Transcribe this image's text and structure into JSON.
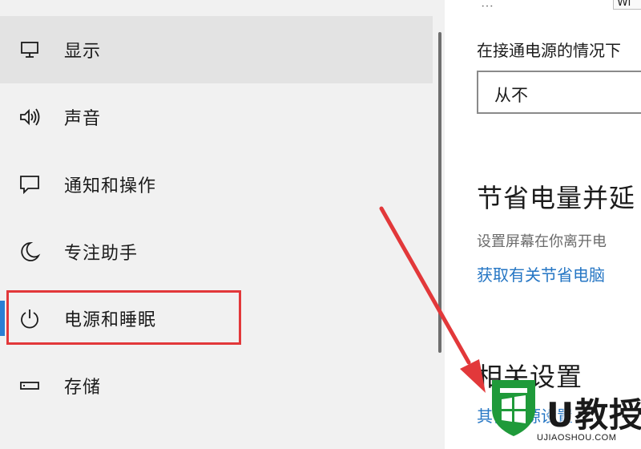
{
  "nav": {
    "items": [
      {
        "label": "显示",
        "icon": "monitor-icon"
      },
      {
        "label": "声音",
        "icon": "speaker-icon"
      },
      {
        "label": "通知和操作",
        "icon": "notification-icon"
      },
      {
        "label": "专注助手",
        "icon": "moon-icon"
      },
      {
        "label": "电源和睡眠",
        "icon": "power-icon",
        "selected": true
      },
      {
        "label": "存储",
        "icon": "storage-icon"
      }
    ]
  },
  "content": {
    "top_partial_text": "Wi",
    "top_partial_left": "…",
    "plugged_in_label": "在接通电源的情况下",
    "plugged_in_value": "从不",
    "section_heading": "节省电量并延",
    "section_description": "设置屏幕在你离开电",
    "section_link": "获取有关节省电脑",
    "related_heading": "相关设置",
    "related_link": "其他电源设置"
  },
  "annotation": {
    "highlight_color": "#e2383a",
    "arrow_color": "#e2383a"
  },
  "watermark": {
    "brand": "U教授",
    "domain": "UJIAOSHOU.COM"
  },
  "colors": {
    "accent": "#2a7fd4",
    "link": "#2576c4"
  }
}
